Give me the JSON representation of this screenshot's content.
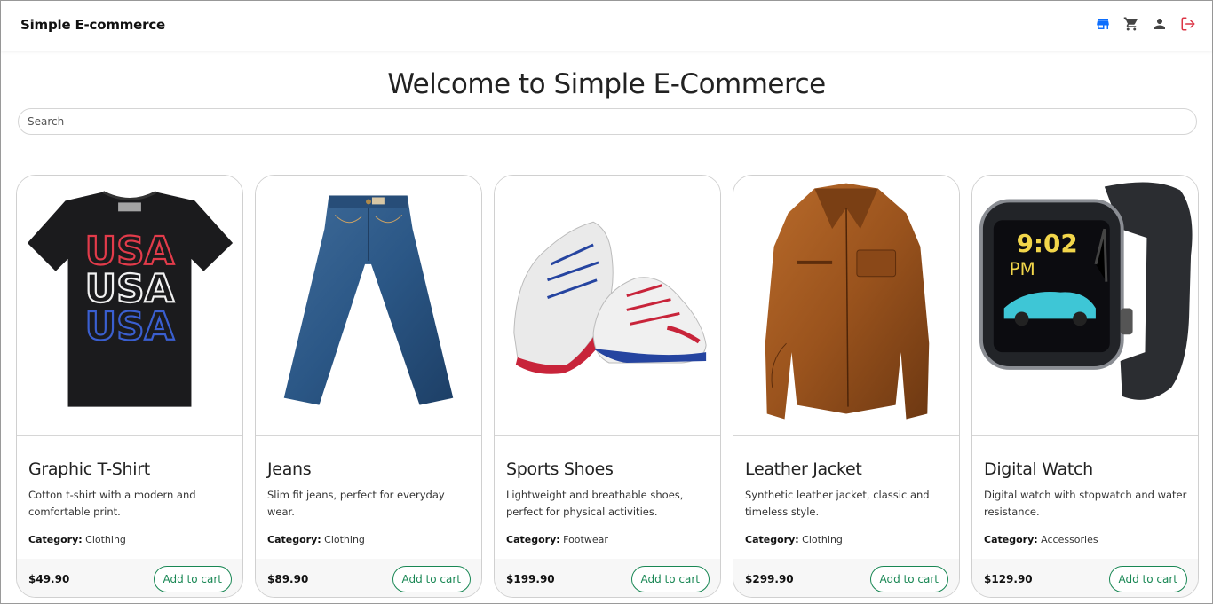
{
  "navbar": {
    "brand": "Simple E-commerce",
    "icons": [
      "store-icon",
      "cart-icon",
      "user-icon",
      "logout-icon"
    ],
    "colors": {
      "store": "#0d6efd",
      "cart": "#444444",
      "user": "#444444",
      "logout": "#dc3545"
    }
  },
  "page": {
    "title": "Welcome to Simple E-Commerce",
    "search_placeholder": "Search"
  },
  "products": [
    {
      "name": "Graphic T-Shirt",
      "description": "Cotton t-shirt with a modern and comfortable print.",
      "category_label": "Category:",
      "category": "Clothing",
      "price": "$49.90",
      "button": "Add to cart",
      "image": "tshirt"
    },
    {
      "name": "Jeans",
      "description": "Slim fit jeans, perfect for everyday wear.",
      "category_label": "Category:",
      "category": "Clothing",
      "price": "$89.90",
      "button": "Add to cart",
      "image": "jeans"
    },
    {
      "name": "Sports Shoes",
      "description": "Lightweight and breathable shoes, perfect for physical activities.",
      "category_label": "Category:",
      "category": "Footwear",
      "price": "$199.90",
      "button": "Add to cart",
      "image": "shoes"
    },
    {
      "name": "Leather Jacket",
      "description": "Synthetic leather jacket, classic and timeless style.",
      "category_label": "Category:",
      "category": "Clothing",
      "price": "$299.90",
      "button": "Add to cart",
      "image": "jacket"
    },
    {
      "name": "Digital Watch",
      "description": "Digital watch with stopwatch and water resistance.",
      "category_label": "Category:",
      "category": "Accessories",
      "price": "$129.90",
      "button": "Add to cart",
      "image": "watch",
      "watch_time": "9:02",
      "watch_ampm": "PM"
    }
  ],
  "tshirt_print": "USA",
  "theme": {
    "accent_green": "#198754"
  }
}
